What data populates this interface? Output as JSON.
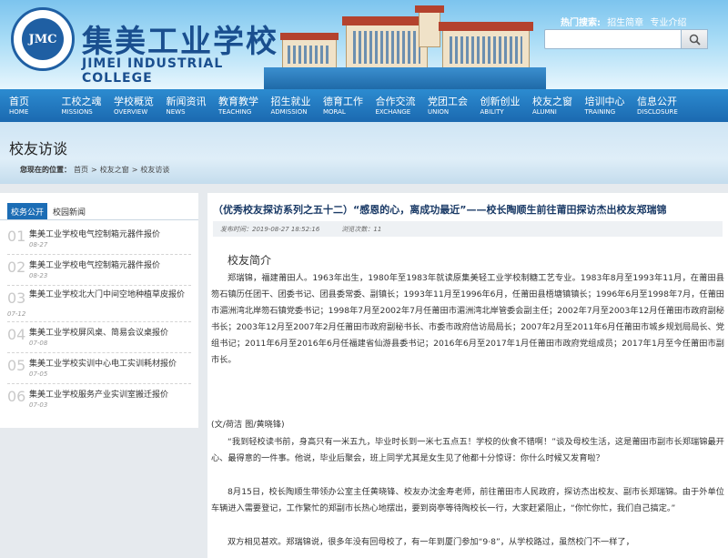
{
  "header": {
    "logo_badge": "JMC",
    "school_name_cn": "集美工业学校",
    "school_name_en": "JIMEI INDUSTRIAL COLLEGE",
    "hot_label": "热门搜索:",
    "hot_links": [
      "招生简章",
      "专业介绍"
    ],
    "search_placeholder": ""
  },
  "nav": [
    {
      "cn": "首页",
      "en": "HOME"
    },
    {
      "cn": "工校之魂",
      "en": "MISSIONS"
    },
    {
      "cn": "学校概览",
      "en": "OVERVIEW"
    },
    {
      "cn": "新闻资讯",
      "en": "NEWS"
    },
    {
      "cn": "教育教学",
      "en": "TEACHING"
    },
    {
      "cn": "招生就业",
      "en": "ADMISSION"
    },
    {
      "cn": "德育工作",
      "en": "MORAL"
    },
    {
      "cn": "合作交流",
      "en": "EXCHANGE"
    },
    {
      "cn": "党团工会",
      "en": "UNION"
    },
    {
      "cn": "创新创业",
      "en": "ABILITY"
    },
    {
      "cn": "校友之窗",
      "en": "ALUMNI"
    },
    {
      "cn": "培训中心",
      "en": "TRAINING"
    },
    {
      "cn": "信息公开",
      "en": "DISCLOSURE"
    }
  ],
  "page": {
    "heading": "校友访谈",
    "breadcrumb_label": "您现在的位置：",
    "breadcrumb": [
      "首页",
      ">",
      "校友之窗",
      ">",
      "校友访谈"
    ]
  },
  "sidebar": {
    "tabs": [
      "校务公开",
      "校园新闻"
    ],
    "items": [
      {
        "num": "01",
        "title": "集美工业学校电气控制箱元器件报价",
        "date": "08-27"
      },
      {
        "num": "02",
        "title": "集美工业学校电气控制箱元器件报价",
        "date": "08-23"
      },
      {
        "num": "03",
        "title": "集美工业学校北大门中间空地种植草皮报价",
        "date": "07-12"
      },
      {
        "num": "04",
        "title": "集美工业学校屏风桌、简易会议桌报价",
        "date": "07-08"
      },
      {
        "num": "05",
        "title": "集美工业学校实训中心电工实训耗材报价",
        "date": "07-05"
      },
      {
        "num": "06",
        "title": "集美工业学校服务产业实训室搬迁报价",
        "date": "07-03"
      }
    ]
  },
  "article": {
    "title": "（优秀校友探访系列之五十二）“感恩的心，离成功最近”——校长陶顺生前往莆田探访杰出校友郑瑞锦",
    "publish_time": "发布时间：2019-08-27 18:52:16",
    "views": "浏览次数：11",
    "section_title": "校友简介",
    "paragraphs": [
      "郑瑞锦，福建莆田人。1963年出生，1980年至1983年就读原集美轻工业学校制糖工艺专业。1983年8月至1993年11月，在莆田县笏石镇历任团干、团委书记、团县委常委、副镇长；1993年11月至1996年6月，任莆田县梧塘镇镇长；1996年6月至1998年7月，任莆田市湄洲湾北岸笏石镇党委书记；1998年7月至2002年7月任莆田市湄洲湾北岸管委会副主任；2002年7月至2003年12月任莆田市政府副秘书长；2003年12月至2007年2月任莆田市政府副秘书长、市委市政府信访局局长；2007年2月至2011年6月任莆田市城乡规划局局长、党组书记；2011年6月至2016年6月任福建省仙游县委书记；2016年6月至2017年1月任莆田市政府党组成员；2017年1月至今任莆田市副市长。",
      "(文/荷洁 图/黄晓锋)",
      "“我到轻校读书前，身高只有一米五九，毕业时长到一米七五点五！学校的伙食不错啊！”谈及母校生活，这是莆田市副市长郑瑞锦最开心、最得意的一件事。他说，毕业后聚会，班上同学尤其是女生见了他都十分惊讶：你什么时候又发育啦？",
      "8月15日，校长陶顺生带领办公室主任黄晓锋、校友办沈金寿老师，前往莆田市人民政府，探访杰出校友、副市长郑瑞锦。由于外单位车辆进入需要登记，工作繁忙的郑副市长热心地摆出，要到岗亭等待陶校长一行，大家赶紧阻止，“你忙你忙，我们自己搞定。”",
      "双方相见甚欢。郑瑞锦说，很多年没有回母校了，有一年到厦门参加“9·8”，从学校路过，虽然校门不一样了，"
    ]
  }
}
